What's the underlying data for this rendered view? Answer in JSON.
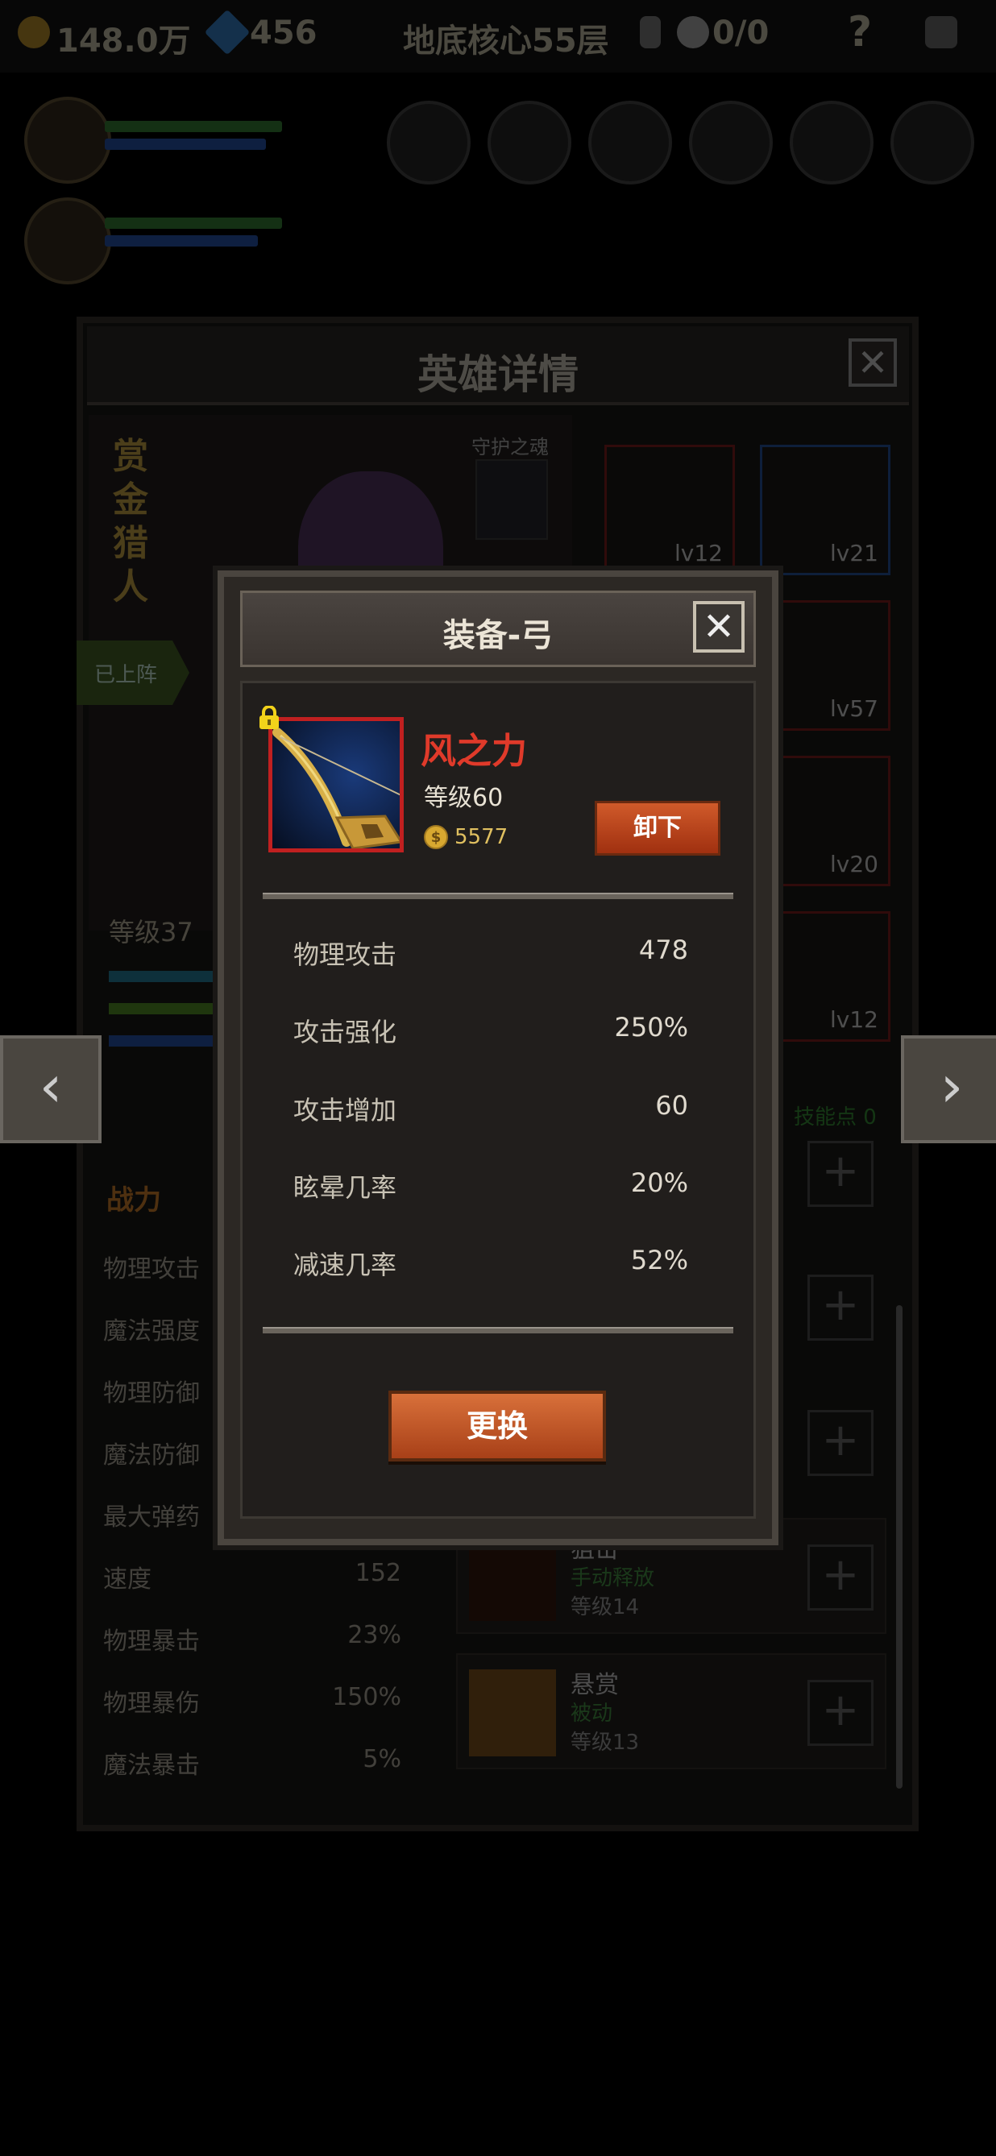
{
  "top_bar": {
    "gold": "148.0万",
    "gems": "456",
    "location": "地底核心55层",
    "keys": "0/0",
    "help": "?"
  },
  "hero_panel": {
    "title": "英雄详情",
    "close": "✕",
    "hero_name": "赏金猎人",
    "guardian_label": "守护之魂",
    "deployed_tag": "已上阵",
    "level_label": "等级37",
    "equipment_slots": [
      {
        "level": "lv12",
        "border": "red"
      },
      {
        "level": "lv21",
        "border": "blue"
      },
      {
        "level": "lv57",
        "border": "red"
      },
      {
        "level": "lv20",
        "border": "red"
      },
      {
        "level": "lv12",
        "border": "red"
      }
    ],
    "skill_points": "技能点 0",
    "stats_title": "战力",
    "stats": [
      {
        "label": "物理攻击",
        "value": ""
      },
      {
        "label": "魔法强度",
        "value": ""
      },
      {
        "label": "物理防御",
        "value": ""
      },
      {
        "label": "魔法防御",
        "value": ""
      },
      {
        "label": "最大弹药",
        "value": ""
      },
      {
        "label": "速度",
        "value": "152"
      },
      {
        "label": "物理暴击",
        "value": "23%"
      },
      {
        "label": "物理暴伤",
        "value": "150%"
      },
      {
        "label": "魔法暴击",
        "value": "5%"
      }
    ],
    "skills": [
      {
        "name": "狙击",
        "type": "手动释放",
        "level": "等级14"
      },
      {
        "name": "悬赏",
        "type": "被动",
        "level": "等级13"
      }
    ],
    "nav_prev": "‹",
    "nav_next": "›"
  },
  "modal": {
    "title": "装备-弓",
    "close": "✕",
    "item_name": "风之力",
    "item_level": "等级60",
    "item_price": "5577",
    "coin_symbol": "$",
    "unequip": "卸下",
    "stats": [
      {
        "label": "物理攻击",
        "value": "478"
      },
      {
        "label": "攻击强化",
        "value": "250%"
      },
      {
        "label": "攻击增加",
        "value": "60"
      },
      {
        "label": "眩晕几率",
        "value": "20%"
      },
      {
        "label": "减速几率",
        "value": "52%"
      }
    ],
    "replace": "更换"
  },
  "colors": {
    "item_name": "#e03a2a",
    "accent_orange": "#c8541f",
    "rarity_red": "#c02020",
    "rarity_blue": "#2a5aa8"
  }
}
